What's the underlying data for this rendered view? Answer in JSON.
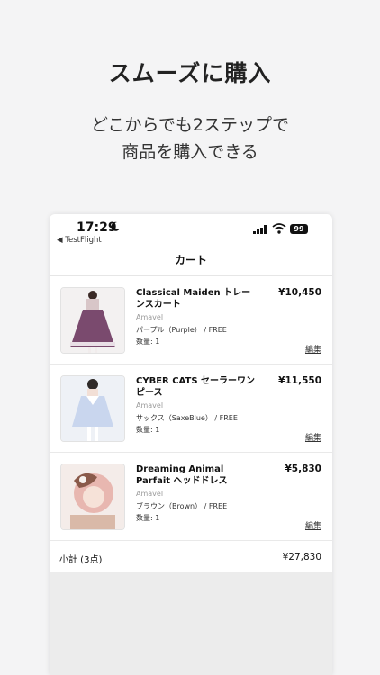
{
  "promo": {
    "headline": "スムーズに購入",
    "subline_1": "どこからでも2ステップで",
    "subline_2": "商品を購入できる"
  },
  "status_bar": {
    "time": "17:29",
    "back_label": "◀ TestFlight",
    "battery": "99"
  },
  "nav": {
    "title": "カート"
  },
  "cart": {
    "items": [
      {
        "title": "Classical Maiden トレーンスカート",
        "price": "¥10,450",
        "brand": "Amavel",
        "variant": "パープル（Purple） / FREE",
        "qty": "数量: 1",
        "edit": "編集"
      },
      {
        "title": "CYBER CATS セーラーワンピース",
        "price": "¥11,550",
        "brand": "Amavel",
        "variant": "サックス（SaxeBlue） / FREE",
        "qty": "数量: 1",
        "edit": "編集"
      },
      {
        "title": "Dreaming Animal Parfait ヘッドドレス",
        "price": "¥5,830",
        "brand": "Amavel",
        "variant": "ブラウン（Brown） / FREE",
        "qty": "数量: 1",
        "edit": "編集"
      }
    ],
    "subtotal_label": "小計 (3点)",
    "subtotal_value": "¥27,830"
  },
  "colors": {
    "dress_purple": "#7a4a6e",
    "dress_blue": "#c9d6ee",
    "hair_pink": "#e8b7b0"
  }
}
